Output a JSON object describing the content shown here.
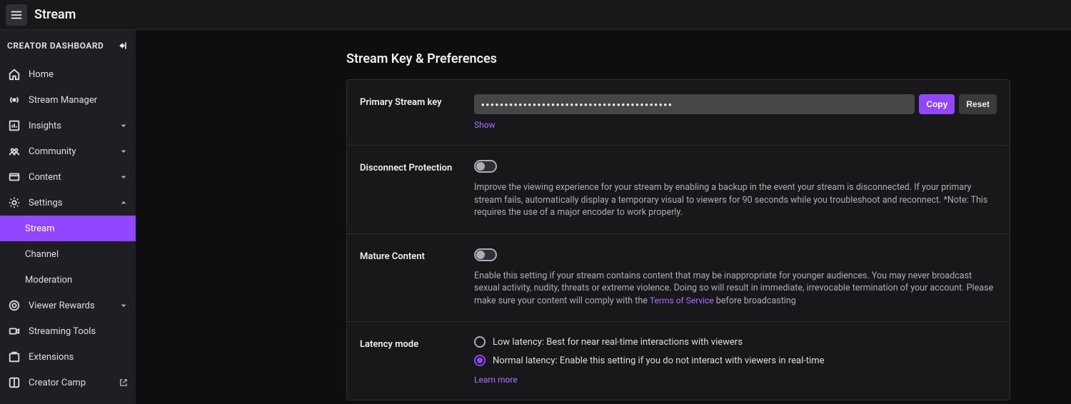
{
  "topbar": {
    "title": "Stream"
  },
  "sidebar": {
    "header": "CREATOR DASHBOARD",
    "items": {
      "home": "Home",
      "stream_manager": "Stream Manager",
      "insights": "Insights",
      "community": "Community",
      "content": "Content",
      "settings": "Settings",
      "settings_children": {
        "stream": "Stream",
        "channel": "Channel",
        "moderation": "Moderation"
      },
      "viewer_rewards": "Viewer Rewards",
      "streaming_tools": "Streaming Tools",
      "extensions": "Extensions",
      "creator_camp": "Creator Camp"
    }
  },
  "page": {
    "title": "Stream Key & Preferences",
    "primary_stream_key": {
      "label": "Primary Stream key",
      "value": "•••••••••••••••••••••••••••••••••••••••••",
      "copy": "Copy",
      "reset": "Reset",
      "show": "Show"
    },
    "disconnect_protection": {
      "label": "Disconnect Protection",
      "enabled": false,
      "desc": "Improve the viewing experience for your stream by enabling a backup in the event your stream is disconnected. If your primary stream fails, automatically display a temporary visual to viewers for 90 seconds while you troubleshoot and reconnect. *Note: This requires the use of a major encoder to work properly."
    },
    "mature_content": {
      "label": "Mature Content",
      "enabled": false,
      "desc_pre": "Enable this setting if your stream contains content that may be inappropriate for younger audiences. You may never broadcast sexual activity, nudity, threats or extreme violence. Doing so will result in immediate, irrevocable termination of your account. Please make sure your content will comply with the ",
      "tos_link": "Terms of Service",
      "desc_post": " before broadcasting"
    },
    "latency_mode": {
      "label": "Latency mode",
      "options": {
        "low": "Low latency: Best for near real-time interactions with viewers",
        "normal": "Normal latency: Enable this setting if you do not interact with viewers in real-time"
      },
      "selected": "normal",
      "learn_more": "Learn more"
    }
  }
}
